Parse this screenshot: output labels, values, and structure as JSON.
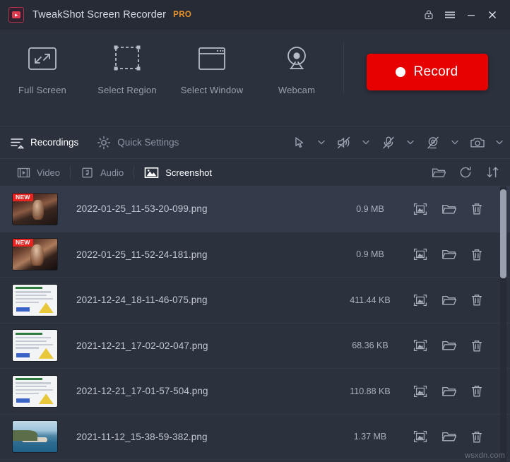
{
  "window": {
    "title": "TweakShot Screen Recorder",
    "badge": "PRO",
    "logo_icon": "app-logo-icon",
    "controls": [
      {
        "name": "lock-icon",
        "label": ""
      },
      {
        "name": "menu-icon",
        "label": ""
      },
      {
        "name": "minimize-icon",
        "label": ""
      },
      {
        "name": "close-icon",
        "label": ""
      }
    ]
  },
  "modes": [
    {
      "label": "Full Screen",
      "icon": "full-screen-icon"
    },
    {
      "label": "Select Region",
      "icon": "select-region-icon"
    },
    {
      "label": "Select Window",
      "icon": "select-window-icon"
    },
    {
      "label": "Webcam",
      "icon": "webcam-icon"
    }
  ],
  "record": {
    "label": "Record",
    "icon": "record-dot-icon",
    "color": "#e60000"
  },
  "nav": {
    "recordings": {
      "label": "Recordings",
      "icon": "recordings-icon"
    },
    "quick_settings": {
      "label": "Quick Settings",
      "icon": "gear-icon"
    },
    "tools": [
      {
        "name": "cursor-icon",
        "label": ""
      },
      {
        "name": "speaker-muted-icon",
        "label": ""
      },
      {
        "name": "microphone-muted-icon",
        "label": ""
      },
      {
        "name": "webcam-off-icon",
        "label": ""
      },
      {
        "name": "camera-icon",
        "label": ""
      }
    ]
  },
  "type_tabs": [
    {
      "label": "Video",
      "icon": "video-icon",
      "active": false
    },
    {
      "label": "Audio",
      "icon": "audio-icon",
      "active": false
    },
    {
      "label": "Screenshot",
      "icon": "screenshot-icon",
      "active": true
    }
  ],
  "list_tools": [
    {
      "name": "open-folder-icon",
      "label": ""
    },
    {
      "name": "refresh-icon",
      "label": ""
    },
    {
      "name": "sort-icon",
      "label": ""
    }
  ],
  "row_actions": [
    {
      "name": "preview-icon",
      "label": ""
    },
    {
      "name": "open-folder-icon",
      "label": ""
    },
    {
      "name": "delete-icon",
      "label": ""
    }
  ],
  "files": [
    {
      "name": "2022-01-25_11-53-20-099.png",
      "size": "0.9 MB",
      "badge": "NEW",
      "thumb": "person",
      "highlight": true
    },
    {
      "name": "2022-01-25_11-52-24-181.png",
      "size": "0.9 MB",
      "badge": "NEW",
      "thumb": "person2",
      "highlight": false
    },
    {
      "name": "2021-12-24_18-11-46-075.png",
      "size": "411.44 KB",
      "badge": "",
      "thumb": "doc",
      "highlight": false
    },
    {
      "name": "2021-12-21_17-02-02-047.png",
      "size": "68.36 KB",
      "badge": "",
      "thumb": "doc",
      "highlight": false
    },
    {
      "name": "2021-12-21_17-01-57-504.png",
      "size": "110.88 KB",
      "badge": "",
      "thumb": "doc",
      "highlight": false
    },
    {
      "name": "2021-11-12_15-38-59-382.png",
      "size": "1.37 MB",
      "badge": "",
      "thumb": "beach",
      "highlight": false
    }
  ],
  "watermark": "wsxdn.com"
}
